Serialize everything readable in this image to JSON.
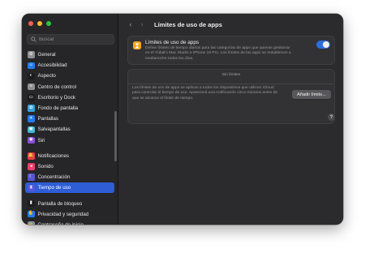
{
  "window": {
    "title": "Límites de uso de apps",
    "nav_back_glyph": "‹",
    "nav_forward_glyph": "›"
  },
  "search": {
    "placeholder": "Buscar"
  },
  "sidebar": {
    "groups": [
      [
        {
          "label": "General",
          "icon": "gear-icon",
          "icon_color": "#8e8e93",
          "glyph": "⚙"
        },
        {
          "label": "Accesibilidad",
          "icon": "accessibility-icon",
          "icon_color": "#1f7cf2",
          "glyph": "☺"
        },
        {
          "label": "Aspecto",
          "icon": "appearance-icon",
          "icon_color": "#1c1c1e",
          "glyph": "◐"
        },
        {
          "label": "Centro de control",
          "icon": "control-center-icon",
          "icon_color": "#8e8e93",
          "glyph": "≡"
        },
        {
          "label": "Escritorio y Dock",
          "icon": "desktop-dock-icon",
          "icon_color": "#1c1c1e",
          "glyph": "▭"
        },
        {
          "label": "Fondo de pantalla",
          "icon": "wallpaper-icon",
          "icon_color": "#33a3e0",
          "glyph": "✿"
        },
        {
          "label": "Pantallas",
          "icon": "displays-icon",
          "icon_color": "#1f7cf2",
          "glyph": "☀"
        },
        {
          "label": "Salvapantallas",
          "icon": "screensaver-icon",
          "icon_color": "#3fb8d8",
          "glyph": "▣"
        },
        {
          "label": "Siri",
          "icon": "siri-icon",
          "icon_color": "#8a4fd8",
          "glyph": "◉"
        }
      ],
      [
        {
          "label": "Notificaciones",
          "icon": "bell-icon",
          "icon_color": "#ef3d48",
          "glyph": "🔔"
        },
        {
          "label": "Sonido",
          "icon": "speaker-icon",
          "icon_color": "#ef3d6b",
          "glyph": "◂"
        },
        {
          "label": "Concentración",
          "icon": "moon-icon",
          "icon_color": "#5856d6",
          "glyph": "☾"
        },
        {
          "label": "Tiempo de uso",
          "icon": "hourglass-icon",
          "icon_color": "#5856d6",
          "glyph": "⧗",
          "selected": true
        }
      ],
      [
        {
          "label": "Pantalla de bloqueo",
          "icon": "lock-screen-icon",
          "icon_color": "#1c1c1e",
          "glyph": "▮"
        },
        {
          "label": "Privacidad y seguridad",
          "icon": "hand-icon",
          "icon_color": "#1f7cf2",
          "glyph": "✋"
        },
        {
          "label": "Contraseña de inicio",
          "icon": "lock-icon",
          "icon_color": "#8e8e93",
          "glyph": "🔒"
        }
      ]
    ]
  },
  "app_limits": {
    "title": "Límites de uso de apps",
    "description": "Define límites de tiempo diarios para las categorías de apps que quieras gestionar en el Yúbal's Mac Studio e iPhone 15 Pro. Los límites de las apps se restablecen a medianoche todos los días.",
    "toggle_on": true,
    "icon": "hourglass-icon"
  },
  "no_limits": {
    "header": "Sin límites",
    "description": "Los límites de uso de apps se aplican a todos los dispositivos que utilicen iCloud para controlar el tiempo de uso. Aparecerá una notificación cinco minutos antes de que se alcance el límite de tiempo.",
    "button_label": "Añadir límite..."
  },
  "help": {
    "glyph": "?"
  }
}
